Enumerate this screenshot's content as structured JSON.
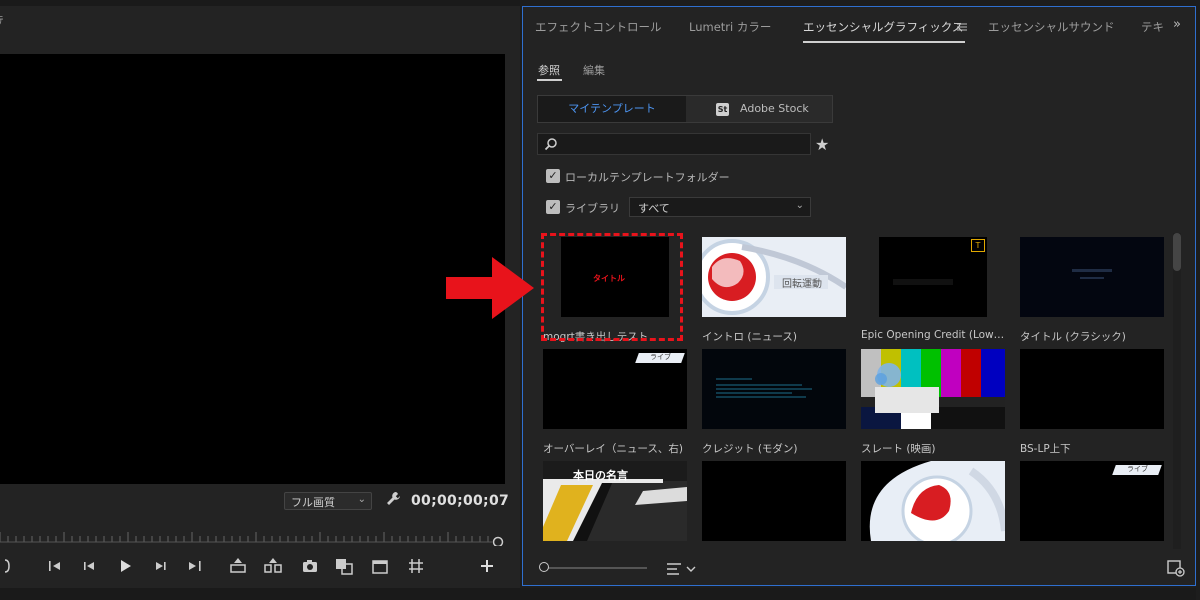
{
  "monitor": {
    "title": "ﾃ",
    "quality": "フル画質",
    "timecode": "00;00;00;07"
  },
  "panel": {
    "tabs": [
      "エフェクトコントロール",
      "Lumetri カラー",
      "エッセンシャルグラフィックス",
      "エッセンシャルサウンド",
      "テキ"
    ],
    "active_tab": "エッセンシャルグラフィックス",
    "overflow": "»",
    "subtabs": [
      "参照",
      "編集"
    ],
    "source_toggle": {
      "my_templates": "マイテンプレート",
      "adobe_stock": "Adobe Stock",
      "stock_badge": "St"
    },
    "search": {
      "placeholder": ""
    },
    "local_folder_label": "ローカルテンプレートフォルダー",
    "library_label": "ライブラリ",
    "library_value": "すべて",
    "templates": [
      {
        "label": "mogrt書き出しテスト",
        "thumb_text": "タイトル"
      },
      {
        "label": "イントロ (ニュース)",
        "thumb_text": "回転運動"
      },
      {
        "label": "Epic Opening Credit (Low…",
        "thumb_text": ""
      },
      {
        "label": "タイトル (クラシック)",
        "thumb_text": ""
      },
      {
        "label": "オーバーレイ（ニュース、右)",
        "thumb_text": "ライブ"
      },
      {
        "label": "クレジット (モダン)",
        "thumb_text": ""
      },
      {
        "label": "スレート (映画)",
        "thumb_text": ""
      },
      {
        "label": "BS-LP上下",
        "thumb_text": ""
      },
      {
        "label": "",
        "thumb_text": "本日の名言"
      },
      {
        "label": "",
        "thumb_text": ""
      },
      {
        "label": "",
        "thumb_text": ""
      },
      {
        "label": "",
        "thumb_text": "ライブ"
      }
    ]
  },
  "colors": {
    "accent_blue": "#4d95f2",
    "highlight_red": "#e8131b",
    "panel_border": "#2f6fcf"
  }
}
